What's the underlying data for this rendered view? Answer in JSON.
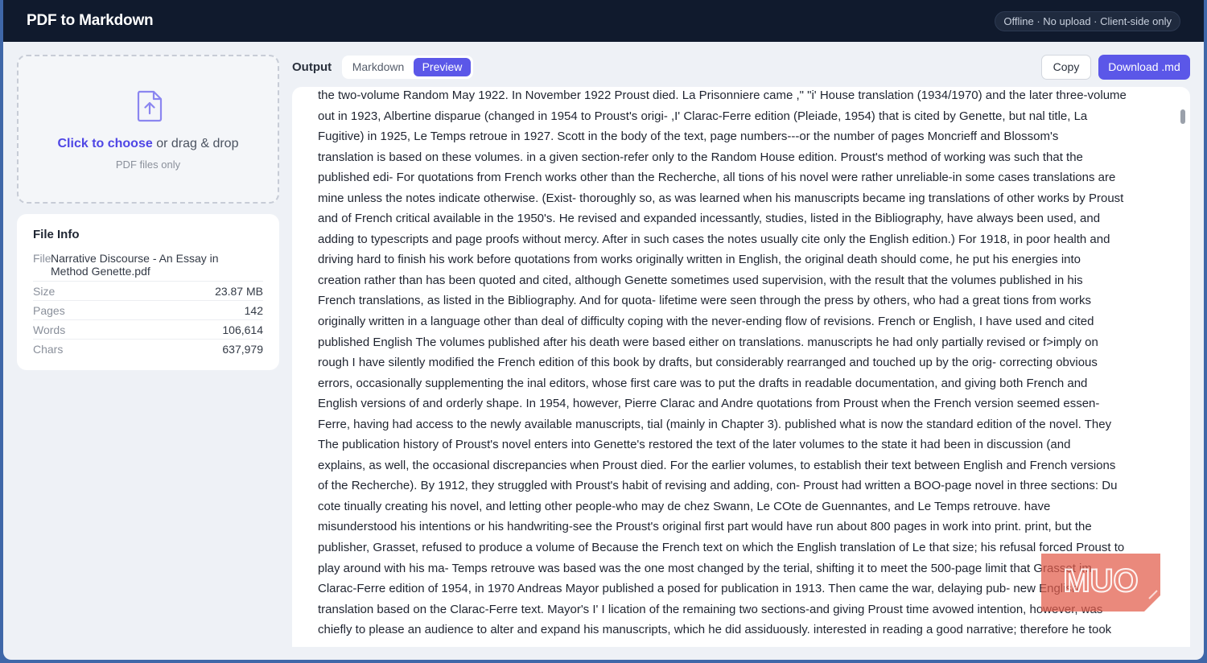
{
  "header": {
    "title": "PDF to Markdown",
    "status": "Offline · No upload · Client-side only"
  },
  "dropzone": {
    "link": "Click to choose",
    "rest": " or drag & drop",
    "hint": "PDF files only"
  },
  "file_info": {
    "title": "File Info",
    "file_label": "File",
    "file_name": "Narrative Discourse - An Essay in Method Genette.pdf",
    "stats": [
      {
        "label": "Size",
        "value": "23.87 MB"
      },
      {
        "label": "Pages",
        "value": "142"
      },
      {
        "label": "Words",
        "value": "106,614"
      },
      {
        "label": "Chars",
        "value": "637,979"
      }
    ]
  },
  "output": {
    "label": "Output",
    "tabs": [
      "Markdown",
      "Preview"
    ],
    "active_tab": "Preview",
    "copy_label": "Copy",
    "download_label": "Download .md"
  },
  "preview_lines": [
    "the two-volume Random May 1922. In November 1922 Proust died. La Prisonniere came ,\" \"i' House translation (1934/1970) and the later three-volume",
    "out in 1923, Albertine disparue (changed in 1954 to Proust's origi- ,I' Clarac-Ferre edition (Pleiade, 1954) that is cited by Genette, but nal title, La",
    "Fugitive) in 1925, Le Temps retroue in 1927. Scott in the body of the text, page numbers---or the number of pages Moncrieff and Blossom's",
    "translation is based on these volumes. in a given section-refer only to the Random House edition. Proust's method of working was such that the",
    "published edi- For quotations from French works other than the Recherche, all tions of his novel were rather unreliable-in some cases translations are",
    "mine unless the notes indicate otherwise. (Exist- thoroughly so, as was learned when his manuscripts became ing translations of other works by Proust",
    "and of French critical available in the 1950's. He revised and expanded incessantly, studies, listed in the Bibliography, have always been used, and",
    "adding to typescripts and page proofs without mercy. After in such cases the notes usually cite only the English edition.) For 1918, in poor health and",
    "driving hard to finish his work before quotations from works originally written in English, the original death should come, he put his energies into",
    "creation rather than has been quoted and cited, although Genette sometimes used supervision, with the result that the volumes published in his",
    "French translations, as listed in the Bibliography. And for quota- lifetime were seen through the press by others, who had a great tions from works",
    "originally written in a language other than deal of difficulty coping with the never-ending flow of revisions. French or English, I have used and cited",
    "published English The volumes published after his death were based either on translations. manuscripts he had only partially revised or f>imply on",
    "rough I have silently modified the French edition of this book by drafts, but considerably rearranged and touched up by the orig- correcting obvious",
    "errors, occasionally supplementing the inal editors, whose first care was to put the drafts in readable documentation, and giving both French and",
    "English versions of and orderly shape. In 1954, however, Pierre Clarac and Andre quotations from Proust when the French version seemed essen-",
    "Ferre, having had access to the newly available manuscripts, tial (mainly in Chapter 3). published what is now the standard edition of the novel. They",
    "The publication history of Proust's novel enters into Genette's restored the text of the later volumes to the state it had been in discussion (and",
    "explains, as well, the occasional discrepancies when Proust died. For the earlier volumes, to establish their text between English and French versions",
    "of the Recherche). By 1912, they struggled with Proust's habit of revising and adding, con- Proust had written a BOO-page novel in three sections: Du",
    "cote tinually creating his novel, and letting other people-who may de chez Swann, Le COte de Guennantes, and Le Temps retrouve. have",
    "misunderstood his intentions or his handwriting-see the Proust's original first part would have run about 800 pages in work into print. print, but the",
    "publisher, Grasset, refused to produce a volume of Because the French text on which the English translation of Le that size; his refusal forced Proust to",
    "play around with his ma- Temps retrouve was based was the one most changed by the terial, shifting it to meet the 500-page limit that Grasset im-",
    "Clarac-Ferre edition of 1954, in 1970 Andreas Mayor published a posed for publication in 1913. Then came the war, delaying pub- new English",
    "translation based on the Clarac-Ferre text. Mayor's I' I lication of the remaining two sections-and giving Proust time avowed intention, however, was",
    "chiefly to please an audience to alter and expand his manuscripts, which he did assiduously. interested in reading a good narrative; therefore he took"
  ],
  "watermark": "MUO",
  "colors": {
    "accent": "#5b57e8",
    "topbar": "#101a2d",
    "background": "#eef1f6"
  }
}
